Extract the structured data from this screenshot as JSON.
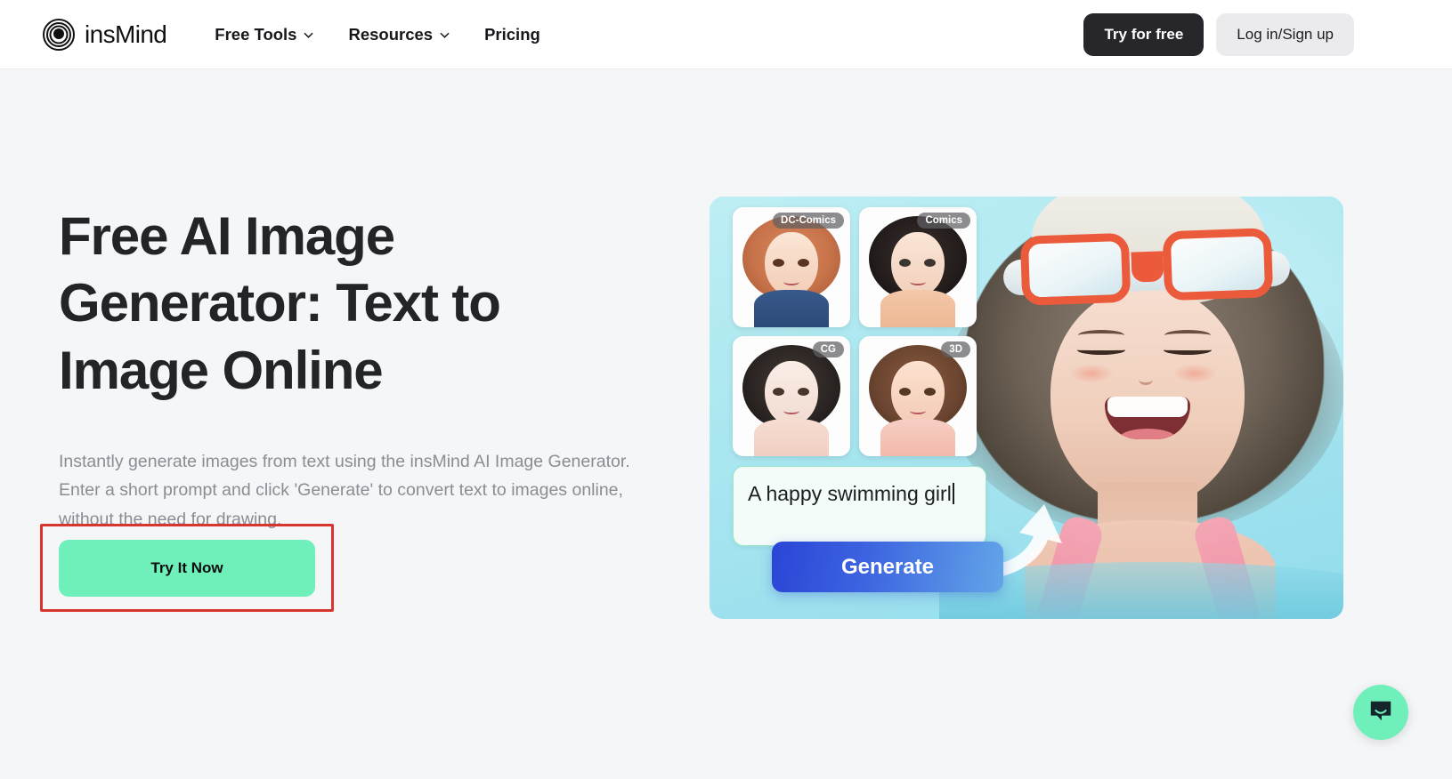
{
  "header": {
    "logo_name": "insMind",
    "logo_icon": "concentric-circles-logo",
    "nav": [
      {
        "label": "Free Tools",
        "has_dropdown": true,
        "icon": "chevron-down-icon"
      },
      {
        "label": "Resources",
        "has_dropdown": true,
        "icon": "chevron-down-icon"
      },
      {
        "label": "Pricing",
        "has_dropdown": false,
        "icon": ""
      }
    ],
    "try_free_label": "Try for free",
    "login_label": "Log in/Sign up"
  },
  "hero": {
    "title": "Free AI Image Generator: Text to Image Online",
    "description": "Instantly generate images from text using the insMind AI Image Generator. Enter a short prompt and click 'Generate' to convert text to images online, without the need for drawing.",
    "cta_label": "Try It Now",
    "cta_highlight_color": "#d8352f",
    "cta_button_color": "#6ff0bb"
  },
  "hero_art": {
    "panel_color": "#b2eaf2",
    "thumbnails": [
      {
        "badge": "DC-Comics",
        "hair": "#c8734a",
        "face": "#f8dcc9",
        "eye": "#5a3522",
        "torso": "#2c4a78"
      },
      {
        "badge": "Comics",
        "hair": "#231d1c",
        "face": "#f7ddcb",
        "eye": "#3b3632",
        "torso": "#edb793"
      },
      {
        "badge": "CG",
        "hair": "#2a2422",
        "face": "#f3e0d6",
        "eye": "#4a352a",
        "torso": "#f0cfc2"
      },
      {
        "badge": "3D",
        "hair": "#6b4530",
        "face": "#f7d9c5",
        "eye": "#54381f",
        "torso": "#f2b9ab"
      }
    ],
    "prompt_value": "A happy swimming girl",
    "generate_label": "Generate",
    "arrow_icon": "curved-arrow-icon",
    "illustration": "anime-girl-swimming-with-orange-goggles"
  },
  "chat": {
    "icon": "chat-bubble-icon",
    "color": "#6ff0bb"
  }
}
